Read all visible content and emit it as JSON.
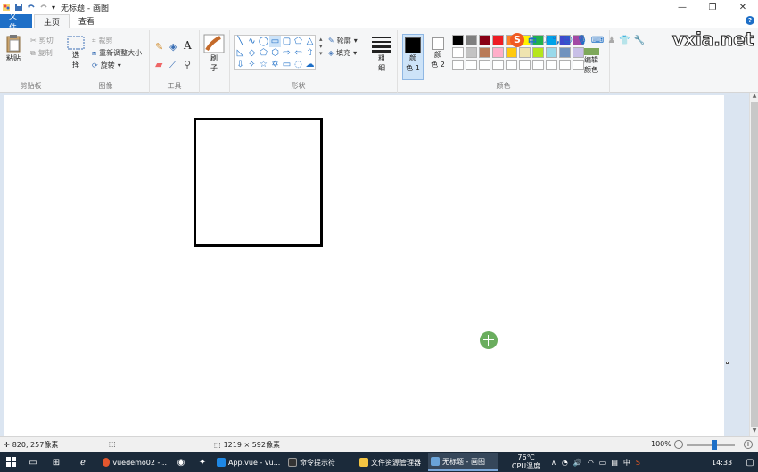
{
  "titlebar": {
    "title": "无标题 - 画图",
    "qa_dropdown": "▾",
    "minimize": "—",
    "restore": "❐",
    "close": "✕"
  },
  "tabs": {
    "file": "文件",
    "home": "主页",
    "view": "查看"
  },
  "ribbon": {
    "clipboard": {
      "label": "剪贴板",
      "paste": "粘贴",
      "cut": "剪切",
      "copy": "复制"
    },
    "image": {
      "label": "图像",
      "select": "选",
      "select2": "择",
      "crop": "裁剪",
      "resize": "重新调整大小",
      "rotate": "旋转"
    },
    "tools": {
      "label": "工具",
      "text_glyph": "A"
    },
    "brushes": {
      "label1": "刷",
      "label2": "子"
    },
    "shapes": {
      "label": "形状",
      "outline": "轮廓",
      "fill": "填充"
    },
    "size": {
      "label1": "粗",
      "label2": "细"
    },
    "colors": {
      "label": "颜色",
      "color1_a": "颜",
      "color1_b": "色 1",
      "color2_a": "颜",
      "color2_b": "色 2",
      "edit_a": "编辑",
      "edit_b": "颜色",
      "palette": [
        "#000000",
        "#7f7f7f",
        "#880015",
        "#ed1c24",
        "#ff7f27",
        "#fff200",
        "#22b14c",
        "#00a2e8",
        "#3f48cc",
        "#a349a4",
        "#ffffff",
        "#c3c3c3",
        "#b97a57",
        "#ffaec9",
        "#ffc90e",
        "#efe4b0",
        "#b5e61d",
        "#99d9ea",
        "#7092be",
        "#c8bfe7",
        "#ffffff",
        "#ffffff",
        "#ffffff",
        "#ffffff",
        "#ffffff",
        "#ffffff",
        "#ffffff",
        "#ffffff",
        "#ffffff",
        "#ffffff"
      ],
      "color1": "#000000",
      "color2": "#ffffff"
    }
  },
  "ime": {
    "s": "S",
    "zh": "中"
  },
  "watermark": "vxia.net",
  "statusbar": {
    "cursor_pos": "820, 257像素",
    "canvas_size": "1219 × 592像素",
    "zoom": "100%",
    "minus": "−",
    "plus": "+"
  },
  "taskbar": {
    "apps": [
      {
        "label": "vuedemo02 -...",
        "color": "#e4572e"
      },
      {
        "label": "App.vue - vu...",
        "color": "#1e88e5"
      },
      {
        "label": "命令提示符",
        "color": "#333333"
      },
      {
        "label": "文件资源管理器",
        "color": "#f4c542"
      },
      {
        "label": "无标题 - 画图",
        "color": "#6aa3d8"
      }
    ],
    "temp": "76℃",
    "temp_label": "CPU温度",
    "ime": "中",
    "time": "14:33"
  }
}
